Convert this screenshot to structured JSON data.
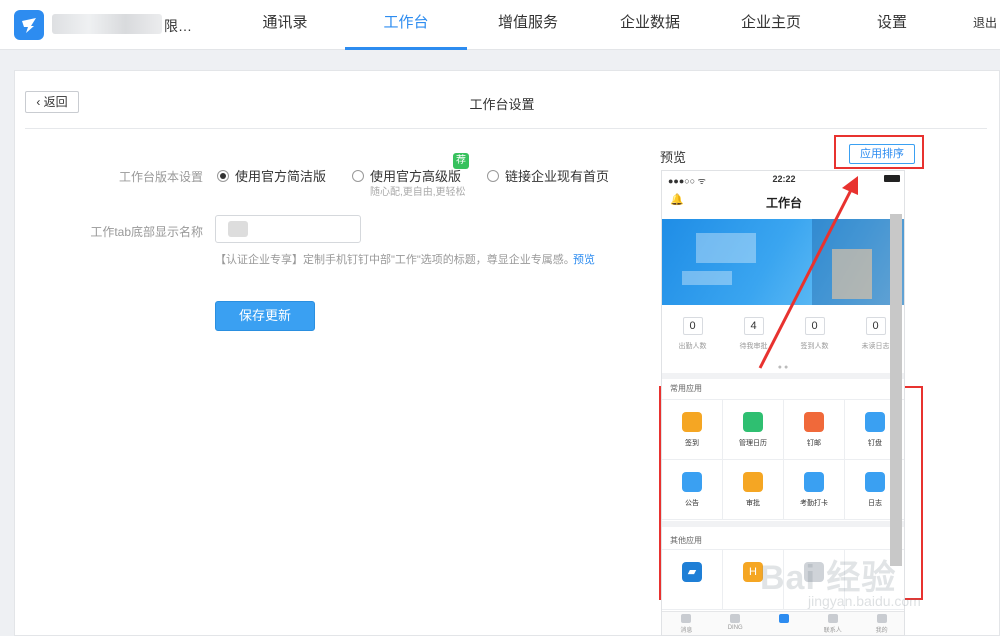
{
  "nav": {
    "company_suffix": "限…",
    "items": [
      "通讯录",
      "工作台",
      "增值服务",
      "企业数据",
      "企业主页",
      "设置",
      "退出"
    ]
  },
  "header": {
    "back_label": "返回",
    "title": "工作台设置"
  },
  "form": {
    "version_label": "工作台版本设置",
    "options": [
      "使用官方简洁版",
      "使用官方高级版",
      "链接企业现有首页"
    ],
    "advanced_hint": "随心配,更自由,更轻松",
    "recommend_tag": "荐",
    "tab_name_label": "工作tab底部显示名称",
    "tab_name_hint": "【认证企业专享】定制手机钉钉中部\"工作\"选项的标题，尊显企业专属感。",
    "tab_name_hint_link": "预览",
    "save_label": "保存更新"
  },
  "preview": {
    "label": "预览",
    "sort_button": "应用排序",
    "status_time": "22:22",
    "status_signal": "●●●○○ ᯤ",
    "title": "工作台",
    "stats": [
      {
        "value": "0",
        "label": "出勤人数"
      },
      {
        "value": "4",
        "label": "待我审批"
      },
      {
        "value": "0",
        "label": "签到人数"
      },
      {
        "value": "0",
        "label": "未读日志"
      }
    ],
    "common_apps_label": "常用应用",
    "common_apps": [
      {
        "name": "签到",
        "icon": "pin-icon",
        "color": "#f5a623"
      },
      {
        "name": "管理日历",
        "icon": "calendar-icon",
        "color": "#2fbf71"
      },
      {
        "name": "钉邮",
        "icon": "mail-icon",
        "color": "#f0693a"
      },
      {
        "name": "钉盘",
        "icon": "cloud-icon",
        "color": "#3aa0f2"
      },
      {
        "name": "公告",
        "icon": "speaker-icon",
        "color": "#3aa0f2"
      },
      {
        "name": "审批",
        "icon": "stamp-icon",
        "color": "#f5a623"
      },
      {
        "name": "考勤打卡",
        "icon": "location-icon",
        "color": "#3aa0f2"
      },
      {
        "name": "日志",
        "icon": "edit-icon",
        "color": "#3aa0f2"
      }
    ],
    "other_apps_label": "其他应用",
    "tabs": [
      "消息",
      "DING",
      "",
      "联系人",
      "我的"
    ]
  },
  "watermark": {
    "main": "Bai 经验",
    "sub": "jingyan.baidu.com"
  }
}
